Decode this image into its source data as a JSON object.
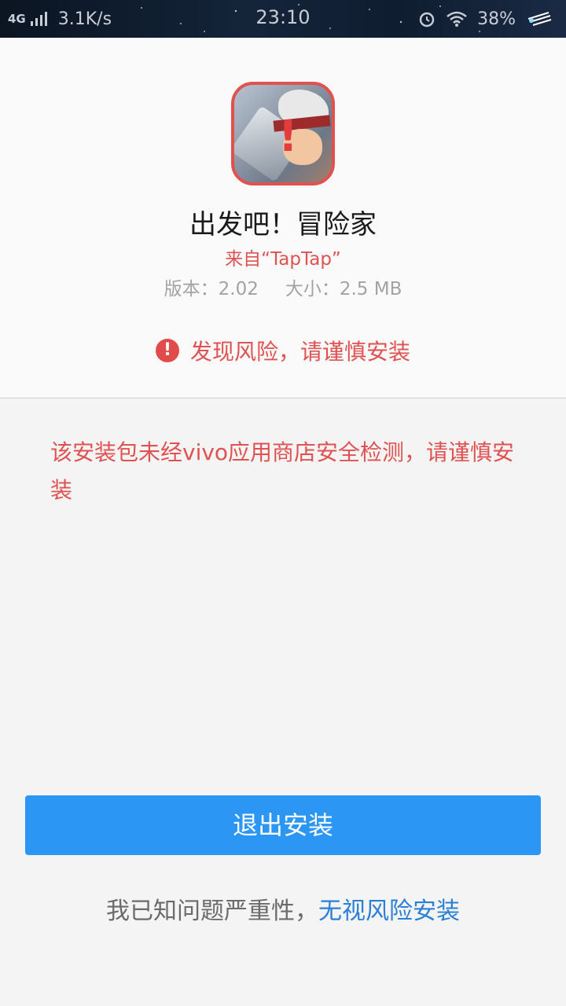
{
  "status_bar": {
    "network": "4G",
    "speed": "3.1K/s",
    "time": "23:10",
    "battery": "38%",
    "icons": [
      "signal-icon",
      "alarm-icon",
      "wifi-icon",
      "comet-icon"
    ]
  },
  "app": {
    "icon": "app-icon-with-alert",
    "name": "出发吧！冒险家",
    "source": "来自“TapTap”",
    "version_label": "版本：2.02",
    "size_label": "大小：2.5 MB"
  },
  "risk": {
    "icon": "alert-circle-icon",
    "text": "发现风险，请谨慎安装"
  },
  "warning_message": "该安装包未经vivo应用商店安全检测，请谨慎安装",
  "actions": {
    "exit_label": "退出安装",
    "ignore_prefix": "我已知问题严重性，",
    "ignore_link": "无视风险安装"
  },
  "colors": {
    "danger": "#e05252",
    "primary": "#2b96f3",
    "link": "#2a7fd6"
  }
}
